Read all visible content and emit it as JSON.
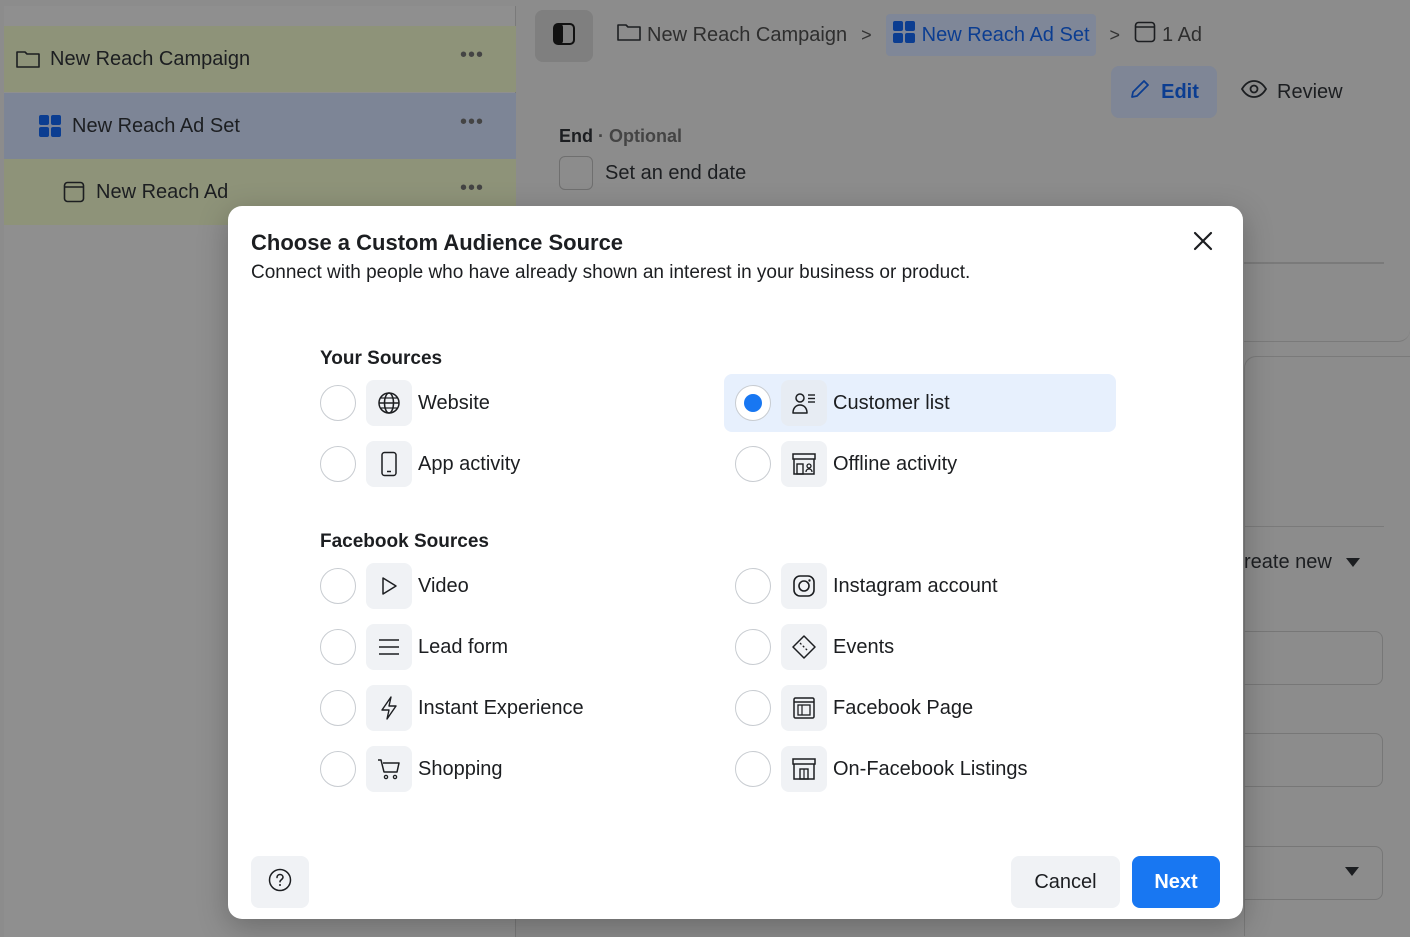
{
  "sidebar": {
    "items": [
      {
        "label": "New Reach Campaign",
        "more": "•••",
        "icon": "folder-icon"
      },
      {
        "label": "New Reach Ad Set",
        "more": "•••",
        "icon": "grid-icon"
      },
      {
        "label": "New Reach Ad",
        "more": "•••",
        "icon": "ad-icon"
      }
    ]
  },
  "breadcrumb": {
    "campaign": "New Reach Campaign",
    "adset": "New Reach Ad Set",
    "ad": "1 Ad"
  },
  "toolbar": {
    "edit_label": "Edit",
    "review_label": "Review"
  },
  "schedule": {
    "end_label": "End",
    "optional": "· Optional",
    "end_checkbox_label": "Set an end date"
  },
  "background": {
    "create_new": "reate new"
  },
  "modal": {
    "title": "Choose a Custom Audience Source",
    "subtitle": "Connect with people who have already shown an interest in your business or product.",
    "your_sources_title": "Your Sources",
    "facebook_sources_title": "Facebook Sources",
    "your_sources": [
      {
        "label": "Website",
        "icon": "globe-icon",
        "selected": false
      },
      {
        "label": "Customer list",
        "icon": "customer-list-icon",
        "selected": true
      },
      {
        "label": "App activity",
        "icon": "phone-icon",
        "selected": false
      },
      {
        "label": "Offline activity",
        "icon": "store-icon",
        "selected": false
      }
    ],
    "facebook_sources": [
      {
        "label": "Video",
        "icon": "play-icon",
        "selected": false
      },
      {
        "label": "Instagram account",
        "icon": "instagram-icon",
        "selected": false
      },
      {
        "label": "Lead form",
        "icon": "lines-icon",
        "selected": false
      },
      {
        "label": "Events",
        "icon": "ticket-icon",
        "selected": false
      },
      {
        "label": "Instant Experience",
        "icon": "bolt-icon",
        "selected": false
      },
      {
        "label": "Facebook Page",
        "icon": "page-icon",
        "selected": false
      },
      {
        "label": "Shopping",
        "icon": "cart-icon",
        "selected": false
      },
      {
        "label": "On-Facebook Listings",
        "icon": "storefront-icon",
        "selected": false
      }
    ],
    "cancel_label": "Cancel",
    "next_label": "Next"
  },
  "colors": {
    "accent": "#1877f2",
    "selected_bg": "#e7f0fd",
    "icon_bg": "#f0f2f5"
  }
}
